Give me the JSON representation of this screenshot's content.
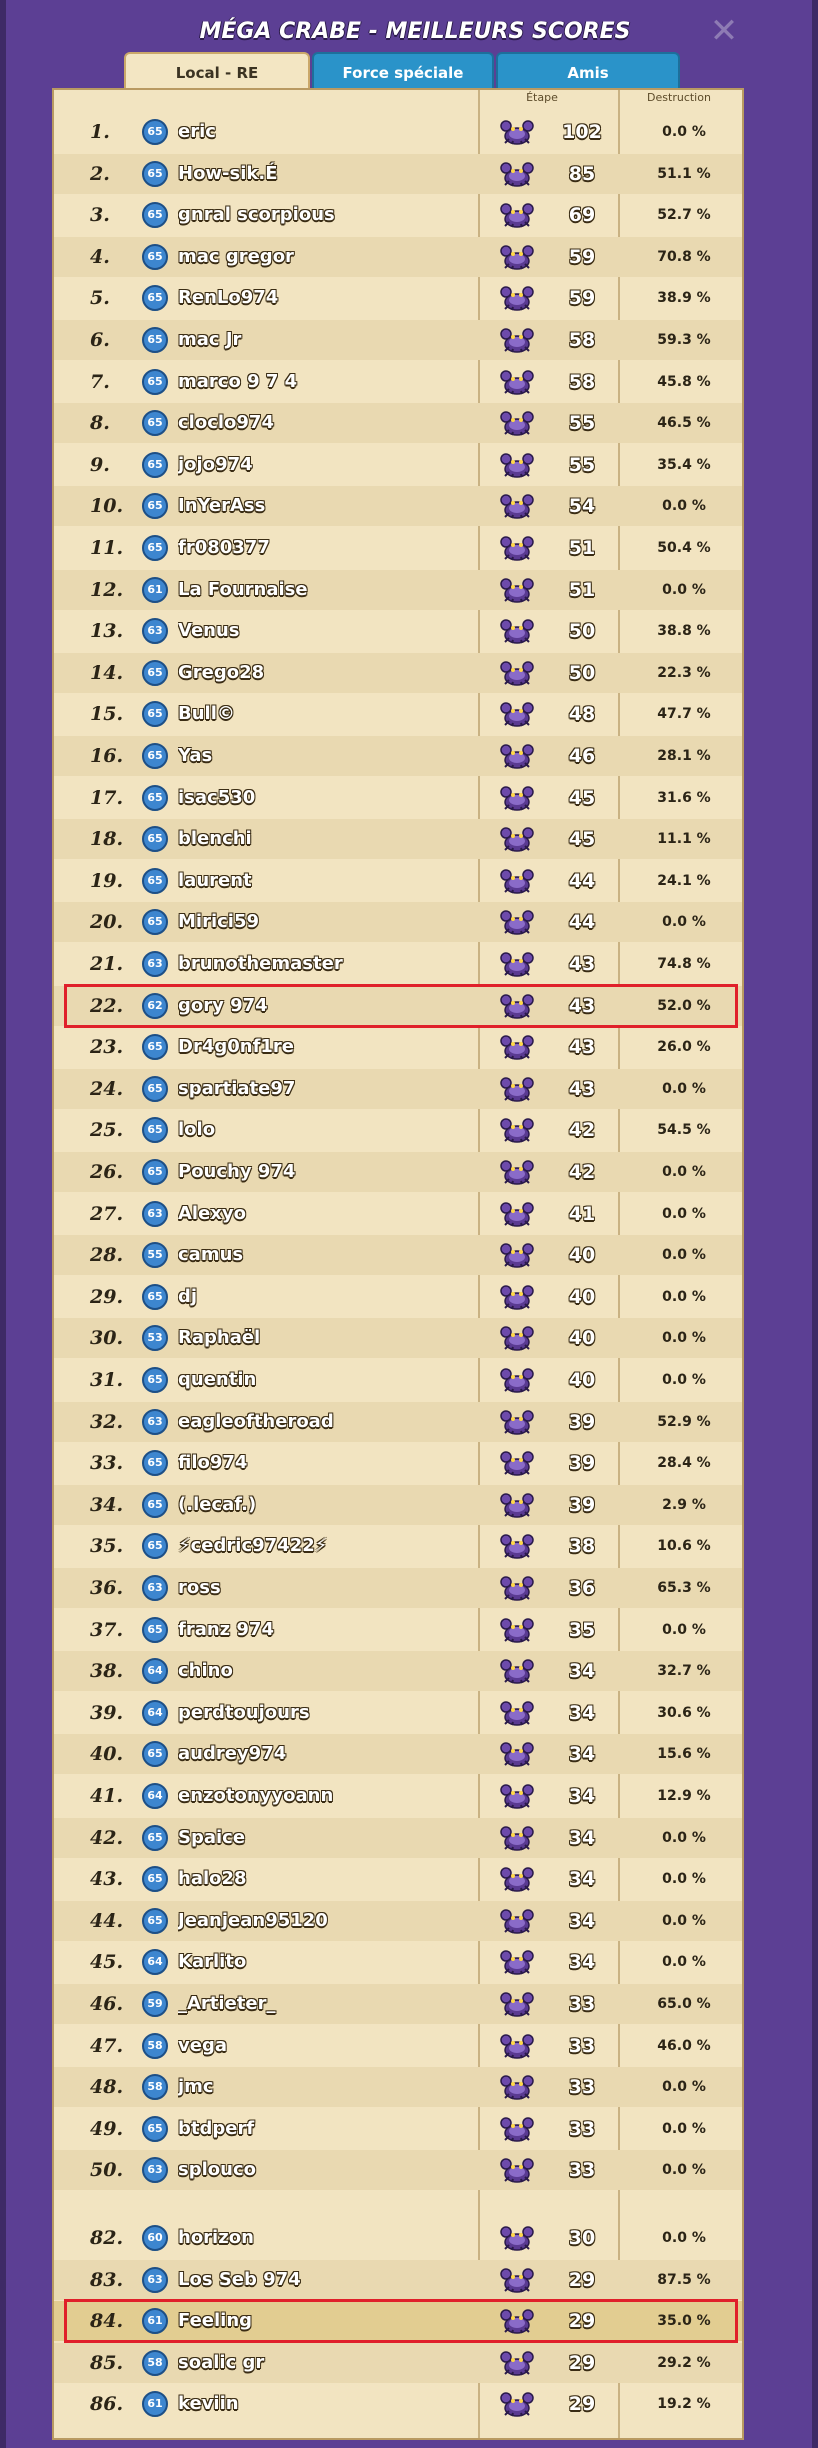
{
  "title": "MÉGA CRABE - MEILLEURS SCORES",
  "close_icon": "close-icon",
  "tabs": [
    {
      "label": "Local - RE",
      "active": true
    },
    {
      "label": "Force spéciale",
      "active": false
    },
    {
      "label": "Amis",
      "active": false
    }
  ],
  "columns": {
    "stage": "Étape",
    "destruction": "Destruction"
  },
  "colors": {
    "panel": "#5c3f94",
    "tab_active": "#f3e6c3",
    "tab_inactive": "#2a93c9",
    "board": "#f2e4c1",
    "highlight_border": "#e0202a",
    "level_badge": "#3d86cf"
  },
  "rows": [
    {
      "rank": "1.",
      "level": "65",
      "name": "eric",
      "stage": "102",
      "destruction": "0.0 %"
    },
    {
      "rank": "2.",
      "level": "65",
      "name": "How-sik.É",
      "stage": "85",
      "destruction": "51.1 %"
    },
    {
      "rank": "3.",
      "level": "65",
      "name": "gnral scorpious",
      "stage": "69",
      "destruction": "52.7 %"
    },
    {
      "rank": "4.",
      "level": "65",
      "name": "mac gregor",
      "stage": "59",
      "destruction": "70.8 %"
    },
    {
      "rank": "5.",
      "level": "65",
      "name": "RenLo974",
      "stage": "59",
      "destruction": "38.9 %"
    },
    {
      "rank": "6.",
      "level": "65",
      "name": "mac Jr",
      "stage": "58",
      "destruction": "59.3 %"
    },
    {
      "rank": "7.",
      "level": "65",
      "name": "marco 9 7 4",
      "stage": "58",
      "destruction": "45.8 %"
    },
    {
      "rank": "8.",
      "level": "65",
      "name": "cloclo974",
      "stage": "55",
      "destruction": "46.5 %"
    },
    {
      "rank": "9.",
      "level": "65",
      "name": "jojo974",
      "stage": "55",
      "destruction": "35.4 %"
    },
    {
      "rank": "10.",
      "level": "65",
      "name": "InYerAss",
      "stage": "54",
      "destruction": "0.0 %"
    },
    {
      "rank": "11.",
      "level": "65",
      "name": "fr080377",
      "stage": "51",
      "destruction": "50.4 %"
    },
    {
      "rank": "12.",
      "level": "61",
      "name": "La Fournaise",
      "stage": "51",
      "destruction": "0.0 %"
    },
    {
      "rank": "13.",
      "level": "63",
      "name": "Venus",
      "stage": "50",
      "destruction": "38.8 %"
    },
    {
      "rank": "14.",
      "level": "65",
      "name": "Grego28",
      "stage": "50",
      "destruction": "22.3 %"
    },
    {
      "rank": "15.",
      "level": "65",
      "name": "Bull©",
      "stage": "48",
      "destruction": "47.7 %"
    },
    {
      "rank": "16.",
      "level": "65",
      "name": "Yas",
      "stage": "46",
      "destruction": "28.1 %"
    },
    {
      "rank": "17.",
      "level": "65",
      "name": "isac530",
      "stage": "45",
      "destruction": "31.6 %"
    },
    {
      "rank": "18.",
      "level": "65",
      "name": "blenchi",
      "stage": "45",
      "destruction": "11.1 %"
    },
    {
      "rank": "19.",
      "level": "65",
      "name": "laurent",
      "stage": "44",
      "destruction": "24.1 %"
    },
    {
      "rank": "20.",
      "level": "65",
      "name": "Mirici59",
      "stage": "44",
      "destruction": "0.0 %"
    },
    {
      "rank": "21.",
      "level": "63",
      "name": "brunothemaster",
      "stage": "43",
      "destruction": "74.8 %"
    },
    {
      "rank": "22.",
      "level": "62",
      "name": "gory 974",
      "stage": "43",
      "destruction": "52.0 %",
      "highlight": true
    },
    {
      "rank": "23.",
      "level": "65",
      "name": "Dr4g0nf1re",
      "stage": "43",
      "destruction": "26.0 %"
    },
    {
      "rank": "24.",
      "level": "65",
      "name": "spartiate97",
      "stage": "43",
      "destruction": "0.0 %"
    },
    {
      "rank": "25.",
      "level": "65",
      "name": "lolo",
      "stage": "42",
      "destruction": "54.5 %"
    },
    {
      "rank": "26.",
      "level": "65",
      "name": "Pouchy 974",
      "stage": "42",
      "destruction": "0.0 %"
    },
    {
      "rank": "27.",
      "level": "63",
      "name": "Alexyo",
      "stage": "41",
      "destruction": "0.0 %"
    },
    {
      "rank": "28.",
      "level": "55",
      "name": "camus",
      "stage": "40",
      "destruction": "0.0 %"
    },
    {
      "rank": "29.",
      "level": "65",
      "name": "dj",
      "stage": "40",
      "destruction": "0.0 %"
    },
    {
      "rank": "30.",
      "level": "53",
      "name": "Raphaël",
      "stage": "40",
      "destruction": "0.0 %"
    },
    {
      "rank": "31.",
      "level": "65",
      "name": "quentin",
      "stage": "40",
      "destruction": "0.0 %"
    },
    {
      "rank": "32.",
      "level": "63",
      "name": "eagleoftheroad",
      "stage": "39",
      "destruction": "52.9 %"
    },
    {
      "rank": "33.",
      "level": "65",
      "name": "filo974",
      "stage": "39",
      "destruction": "28.4 %"
    },
    {
      "rank": "34.",
      "level": "65",
      "name": "(.lecaf.)",
      "stage": "39",
      "destruction": "2.9 %"
    },
    {
      "rank": "35.",
      "level": "65",
      "name": "⚡cedric97422⚡",
      "stage": "38",
      "destruction": "10.6 %"
    },
    {
      "rank": "36.",
      "level": "63",
      "name": "ross",
      "stage": "36",
      "destruction": "65.3 %"
    },
    {
      "rank": "37.",
      "level": "65",
      "name": "franz 974",
      "stage": "35",
      "destruction": "0.0 %"
    },
    {
      "rank": "38.",
      "level": "64",
      "name": "chino",
      "stage": "34",
      "destruction": "32.7 %"
    },
    {
      "rank": "39.",
      "level": "64",
      "name": "perdtoujours",
      "stage": "34",
      "destruction": "30.6 %"
    },
    {
      "rank": "40.",
      "level": "65",
      "name": "audrey974",
      "stage": "34",
      "destruction": "15.6 %"
    },
    {
      "rank": "41.",
      "level": "64",
      "name": "enzotonyyoann",
      "stage": "34",
      "destruction": "12.9 %"
    },
    {
      "rank": "42.",
      "level": "65",
      "name": "Spaice",
      "stage": "34",
      "destruction": "0.0 %"
    },
    {
      "rank": "43.",
      "level": "65",
      "name": "halo28",
      "stage": "34",
      "destruction": "0.0 %"
    },
    {
      "rank": "44.",
      "level": "65",
      "name": "Jeanjean95120",
      "stage": "34",
      "destruction": "0.0 %"
    },
    {
      "rank": "45.",
      "level": "64",
      "name": "Karlito",
      "stage": "34",
      "destruction": "0.0 %"
    },
    {
      "rank": "46.",
      "level": "59",
      "name": "_Artieter_",
      "stage": "33",
      "destruction": "65.0 %"
    },
    {
      "rank": "47.",
      "level": "58",
      "name": "vega",
      "stage": "33",
      "destruction": "46.0 %"
    },
    {
      "rank": "48.",
      "level": "58",
      "name": "jmc",
      "stage": "33",
      "destruction": "0.0 %"
    },
    {
      "rank": "49.",
      "level": "65",
      "name": "btdperf",
      "stage": "33",
      "destruction": "0.0 %"
    },
    {
      "rank": "50.",
      "level": "63",
      "name": "splouco",
      "stage": "33",
      "destruction": "0.0 %"
    },
    {
      "rank": "82.",
      "level": "60",
      "name": "horizon",
      "stage": "30",
      "destruction": "0.0 %"
    },
    {
      "rank": "83.",
      "level": "63",
      "name": "Los Seb 974",
      "stage": "29",
      "destruction": "87.5 %"
    },
    {
      "rank": "84.",
      "level": "61",
      "name": "Feeling",
      "stage": "29",
      "destruction": "35.0 %",
      "highlight": true,
      "self": true
    },
    {
      "rank": "85.",
      "level": "58",
      "name": "soalic gr",
      "stage": "29",
      "destruction": "29.2 %"
    },
    {
      "rank": "86.",
      "level": "61",
      "name": "keviin",
      "stage": "29",
      "destruction": "19.2 %"
    }
  ]
}
